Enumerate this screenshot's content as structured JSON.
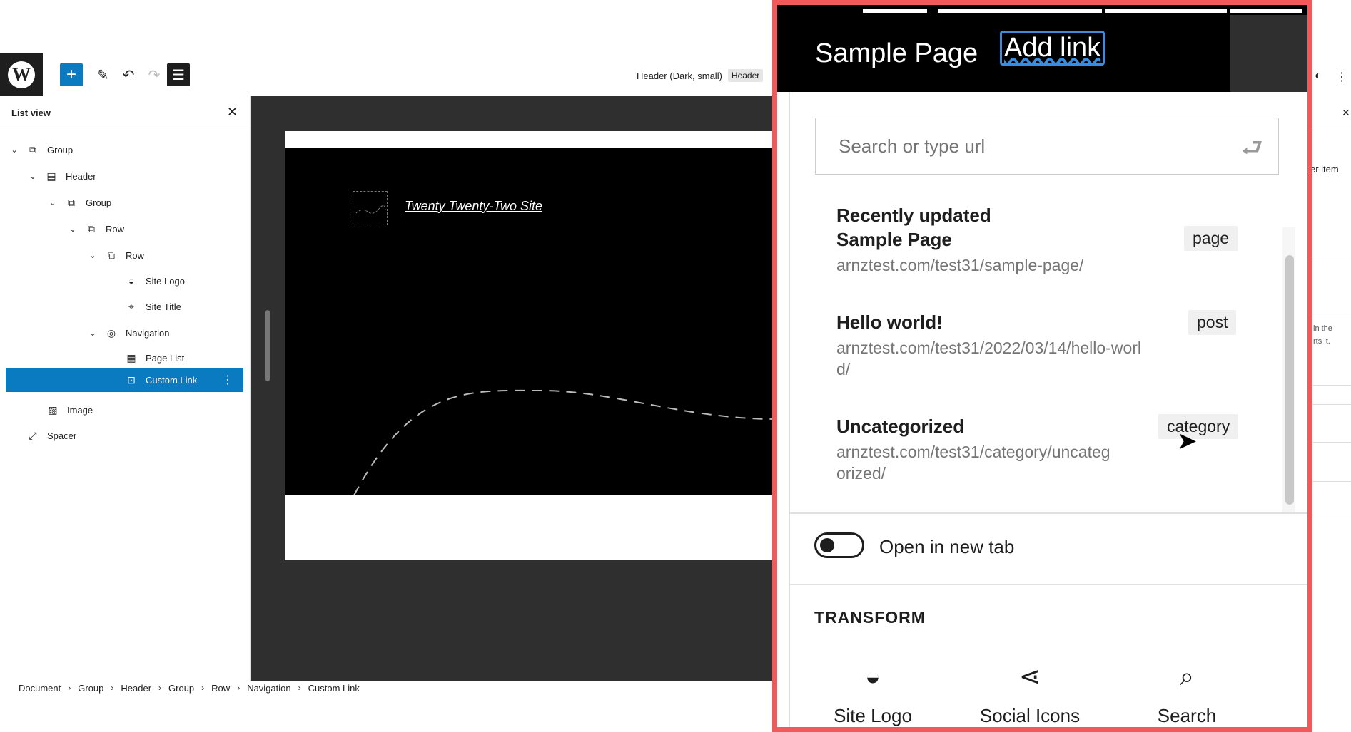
{
  "toolbar": {
    "add_icon": "+",
    "edit_icon": "✎",
    "undo_icon": "↶",
    "redo_icon": "↷",
    "listview_icon": "☰",
    "doc_title": "Header (Dark, small)",
    "doc_tag": "Header"
  },
  "sidebar": {
    "title": "List view",
    "close_icon": "✕",
    "items": [
      {
        "label": "Group",
        "icon": "⧉"
      },
      {
        "label": "Header",
        "icon": "▤"
      },
      {
        "label": "Group",
        "icon": "⧉"
      },
      {
        "label": "Row",
        "icon": "⧉"
      },
      {
        "label": "Row",
        "icon": "⧉"
      },
      {
        "label": "Site Logo",
        "icon": "◒"
      },
      {
        "label": "Site Title",
        "icon": "⌖"
      },
      {
        "label": "Navigation",
        "icon": "◎"
      },
      {
        "label": "Page List",
        "icon": "▦"
      },
      {
        "label": "Custom Link",
        "icon": "⊡",
        "more_icon": "⋮"
      },
      {
        "label": "Image",
        "icon": "▨"
      },
      {
        "label": "Spacer",
        "icon": "⤢"
      }
    ]
  },
  "canvas": {
    "site_title": "Twenty Twenty-Two Site"
  },
  "breadcrumb": [
    "Document",
    "Group",
    "Header",
    "Group",
    "Row",
    "Navigation",
    "Custom Link"
  ],
  "right_peek": {
    "text1": "er item",
    "text2": "in the",
    "text3": "rts it."
  },
  "zoom": {
    "nav_sample": "Sample Page",
    "nav_addlink": "Add link",
    "search_placeholder": "Search or type url",
    "enter_icon": "⮐",
    "results": [
      {
        "title_line1": "Recently updated",
        "title_line2": "Sample Page",
        "url": "arnztest.com/test31/sample-page/",
        "type": "page"
      },
      {
        "title": "Hello world!",
        "url_line1": "arnztest.com/test31/2022/03/14/hello-worl",
        "url_line2": "d/",
        "type": "post"
      },
      {
        "title": "Uncategorized",
        "url_line1": "arnztest.com/test31/category/uncateg",
        "url_line2": "orized/",
        "type": "category"
      }
    ],
    "toggle_label": "Open in new tab",
    "transform_title": "TRANSFORM",
    "transforms": [
      {
        "label": "Site Logo",
        "icon": "◒"
      },
      {
        "label": "Social Icons",
        "icon": "⋖"
      },
      {
        "label": "Search",
        "icon": "⌕"
      }
    ]
  }
}
